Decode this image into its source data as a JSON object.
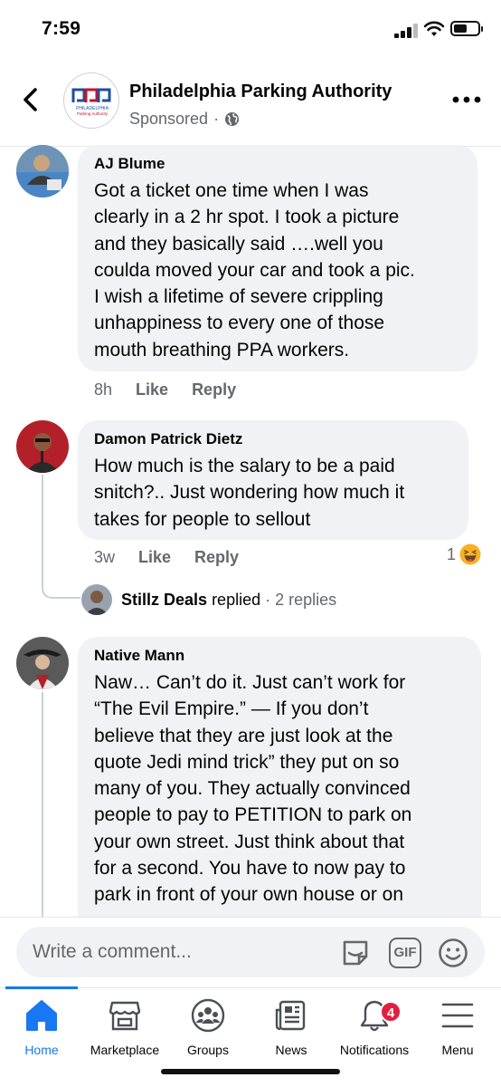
{
  "status_bar": {
    "time": "7:59",
    "battery_level": 0.55
  },
  "header": {
    "page_name": "Philadelphia Parking Authority",
    "sponsored": "Sponsored",
    "separator": "·",
    "logo_text": [
      "PHILADELPHIA",
      "Parking Authority"
    ]
  },
  "comments": [
    {
      "author": "AJ Blume",
      "text": "Got a ticket one time when I was\nclearly in a 2 hr spot. I took a picture\nand they basically said ….well you\ncoulda moved your car and took a pic.\nI wish a lifetime of severe crippling\nunhappiness to every one of those\nmouth breathing PPA workers.",
      "time": "8h",
      "like": "Like",
      "reply": "Reply"
    },
    {
      "author": "Damon Patrick Dietz",
      "text": "How much is the salary to be a paid\nsnitch?.. Just wondering how much it\ntakes for people to sellout",
      "time": "3w",
      "like": "Like",
      "reply": "Reply",
      "reaction_count": "1",
      "reaction_icon": "haha-emoji",
      "replies_preview": {
        "name": "Stillz Deals",
        "action": "replied",
        "separator": "·",
        "count": "2 replies"
      }
    },
    {
      "author": "Native Mann",
      "text": "Naw… Can’t do it. Just can’t work for\n“The Evil Empire.” —  If you don’t\nbelieve that they are just look at the\nquote Jedi mind trick” they put on so\nmany of you. They actually convinced\npeople to pay to PETITION to park on\nyour own street. Just think about that\nfor a second. You have to now pay to\npark in front of your own house or on"
    }
  ],
  "comment_bar": {
    "placeholder": "Write a comment...",
    "icons": [
      "sticker-icon",
      "gif-icon",
      "emoji-icon"
    ],
    "gif_label": "GIF"
  },
  "bottom_nav": {
    "items": [
      {
        "label": "Home",
        "icon": "home-icon",
        "active": true
      },
      {
        "label": "Marketplace",
        "icon": "marketplace-icon"
      },
      {
        "label": "Groups",
        "icon": "groups-icon"
      },
      {
        "label": "News",
        "icon": "news-icon"
      },
      {
        "label": "Notifications",
        "icon": "bell-icon",
        "badge": "4"
      },
      {
        "label": "Menu",
        "icon": "menu-icon"
      }
    ]
  },
  "colors": {
    "accent": "#1877f2",
    "bubble": "#f0f2f5",
    "secondary_text": "#65676b",
    "badge": "#e41e3f"
  }
}
